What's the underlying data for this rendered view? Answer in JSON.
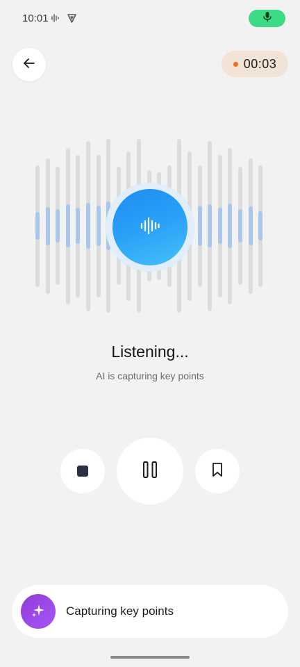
{
  "status_bar": {
    "time": "10:01",
    "icons": [
      "waveform-icon",
      "shield-icon"
    ],
    "mic_indicator_color": "#3ddc84"
  },
  "header": {
    "back_icon": "arrow-left-icon",
    "timer": "00:03",
    "recording_dot_color": "#f26b1d"
  },
  "main": {
    "orb_icon": "waveform-icon",
    "title": "Listening...",
    "subtitle": "AI is capturing key points"
  },
  "controls": {
    "stop_icon": "stop-icon",
    "pause_icon": "pause-icon",
    "bookmark_icon": "bookmark-icon"
  },
  "bottom_card": {
    "icon": "sparkle-icon",
    "label": "Capturing key points"
  },
  "colors": {
    "accent_blue": "#1e8cf2",
    "purple": "#a855f7",
    "background": "#f2f2f2"
  }
}
